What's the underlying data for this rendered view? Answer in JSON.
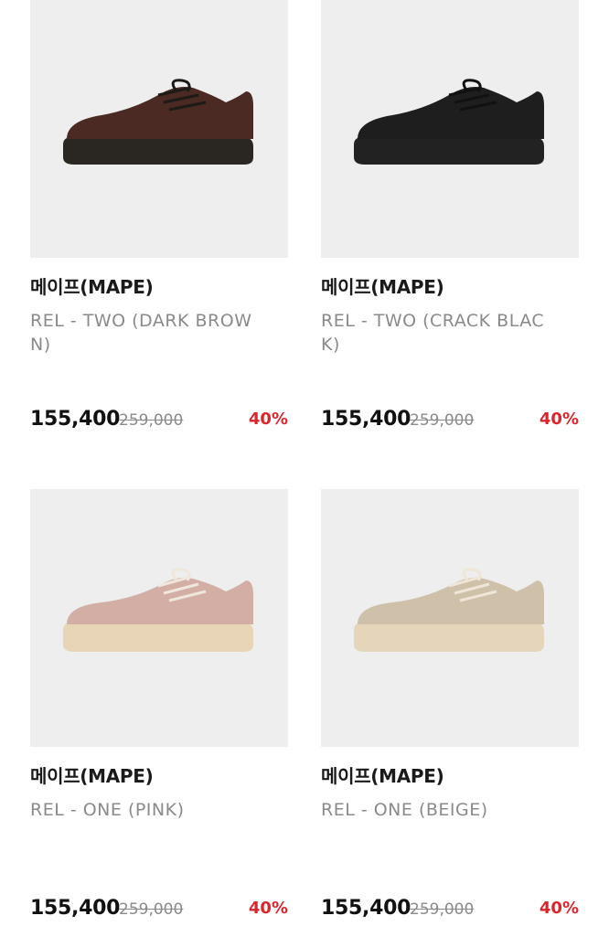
{
  "products": [
    {
      "brand": "메이프(MAPE)",
      "name": "REL - TWO (DARK BROWN)",
      "price": "155,400",
      "original_price": "259,000",
      "discount": "40%",
      "image": {
        "icon": "shoe-image",
        "upper_color": "#4a2a22",
        "sole_color": "#2a2622",
        "lace_color": "#1d1a18"
      }
    },
    {
      "brand": "메이프(MAPE)",
      "name": "REL - TWO (CRACK BLACK)",
      "price": "155,400",
      "original_price": "259,000",
      "discount": "40%",
      "image": {
        "icon": "shoe-image",
        "upper_color": "#1e1e1e",
        "sole_color": "#222222",
        "lace_color": "#111111"
      }
    },
    {
      "brand": "메이프(MAPE)",
      "name": "REL - ONE (PINK)",
      "price": "155,400",
      "original_price": "259,000",
      "discount": "40%",
      "image": {
        "icon": "shoe-image",
        "upper_color": "#d3aea5",
        "sole_color": "#e8d5b8",
        "lace_color": "#efe6dc"
      }
    },
    {
      "brand": "메이프(MAPE)",
      "name": "REL - ONE (BEIGE)",
      "price": "155,400",
      "original_price": "259,000",
      "discount": "40%",
      "image": {
        "icon": "shoe-image",
        "upper_color": "#cfc0aa",
        "sole_color": "#e5d6bb",
        "lace_color": "#efe6d8"
      }
    }
  ],
  "colors": {
    "thumb_background": "#eeeeee",
    "discount": "#d9262c",
    "muted_text": "#8a8a8a"
  }
}
